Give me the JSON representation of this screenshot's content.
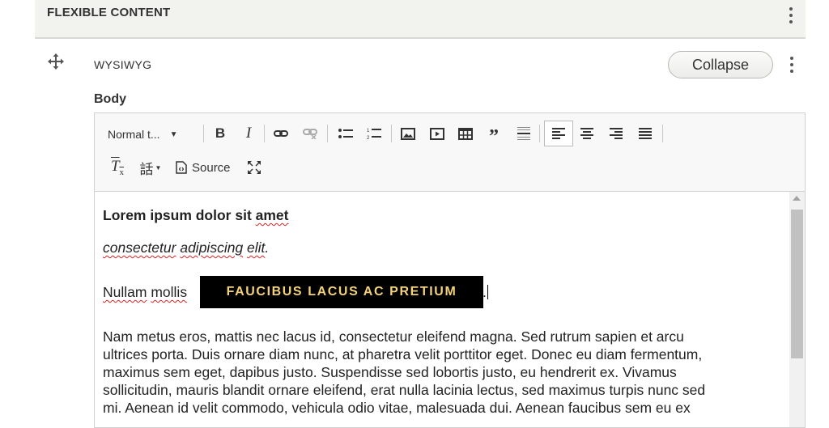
{
  "flexible_content": {
    "title": "FLEXIBLE CONTENT"
  },
  "paragraph": {
    "type_label": "WYSIWYG",
    "collapse_label": "Collapse"
  },
  "body_field": {
    "label": "Body"
  },
  "toolbar": {
    "format_select": "Normal t...",
    "source_label": "Source",
    "buttons": [
      "bold",
      "italic",
      "link",
      "unlink",
      "bulleted-list",
      "numbered-list",
      "image",
      "media",
      "table",
      "blockquote",
      "horizontal-line",
      "align-left",
      "align-center",
      "align-right",
      "align-justify",
      "remove-format",
      "language",
      "source",
      "maximize"
    ]
  },
  "content": {
    "heading": {
      "plain": "Lorem ipsum dolor sit ",
      "sq": "amet"
    },
    "line2": {
      "w1": "consectetur",
      "sp1": " ",
      "w2": "adipiscing",
      "sp2": " ",
      "w3": "elit",
      "tail": "."
    },
    "line3": {
      "w1": "Nullam",
      "sp": " ",
      "w2": "mollis",
      "cta": "FAUCIBUS LACUS AC PRETIUM",
      "after": "."
    },
    "para_lines": [
      "Nam metus eros, mattis nec lacus id, consectetur eleifend magna. Sed rutrum sapien et arcu",
      "ultrices porta. Duis ornare diam nunc, at pharetra velit porttitor eget. Donec eu diam fermentum,",
      "maximus sem eget, dapibus justo. Suspendisse sed lobortis justo, eu hendrerit ex. Vivamus",
      "sollicitudin, mauris blandit ornare eleifend, erat nulla lacinia lectus, sed maximus turpis nunc sed",
      "mi. Aenean id velit commodo, vehicula odio vitae, malesuada dui. Aenean faucibus sem eu ex"
    ]
  }
}
